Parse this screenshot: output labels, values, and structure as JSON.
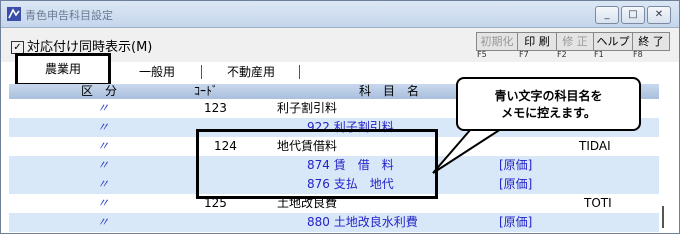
{
  "window": {
    "title": "青色申告科目設定",
    "min_glyph": "_",
    "max_glyph": "□",
    "close_glyph": "✕"
  },
  "toolbar": {
    "checkbox_label": "対応付け同時表示(M)",
    "checked": true,
    "buttons": [
      {
        "label": "初期化",
        "key": "F5"
      },
      {
        "label": "印 刷",
        "key": "F7"
      },
      {
        "label": "修 正",
        "key": "F2"
      },
      {
        "label": "ヘルプ",
        "key": "F1"
      },
      {
        "label": "終 了",
        "key": "F8"
      }
    ]
  },
  "tabs": [
    "農業用",
    "一般用",
    "不動産用"
  ],
  "header": {
    "kubun": "区　分",
    "code": "ｺｰﾄﾞ",
    "kamoku": "科　目　名"
  },
  "rows": [
    {
      "kubun": "〃",
      "code": "123",
      "name": "利子割引料",
      "sub": "",
      "memo": "",
      "extra": ""
    },
    {
      "kubun": "〃",
      "code": "",
      "name": "",
      "sub": "922  利子割引料",
      "memo": "",
      "extra": ""
    },
    {
      "kubun": "〃",
      "code": "124",
      "name": "地代賃借料",
      "sub": "",
      "memo": "",
      "extra": "TIDAI"
    },
    {
      "kubun": "〃",
      "code": "",
      "name": "",
      "sub": "874  賃　借　料",
      "memo": "[原価]",
      "extra": ""
    },
    {
      "kubun": "〃",
      "code": "",
      "name": "",
      "sub": "876  支払　地代",
      "memo": "[原価]",
      "extra": ""
    },
    {
      "kubun": "〃",
      "code": "125",
      "name": "土地改良費",
      "sub": "",
      "memo": "",
      "extra": "TOTI"
    },
    {
      "kubun": "〃",
      "code": "",
      "name": "",
      "sub": "880  土地改良水利費",
      "memo": "[原価]",
      "extra": ""
    }
  ],
  "callout": {
    "line1": "青い文字の科目名を",
    "line2": "メモに控えます。"
  },
  "colors": {
    "accent_blue": "#2323c8",
    "row_highlight": "#d9e8f9",
    "header_bg": "#b5c9e4"
  }
}
